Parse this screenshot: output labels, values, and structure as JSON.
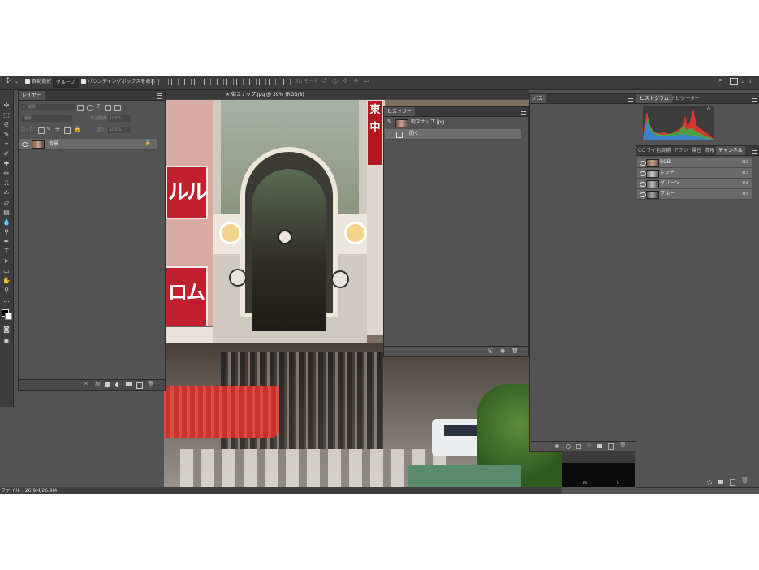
{
  "options_bar": {
    "auto_select_label": "自動選択",
    "auto_select_target": "グループ",
    "transform_label": "バウンディングボックスを表示",
    "mode_3d_label": "3D モード"
  },
  "document": {
    "tab_title": "街スナップ.jpg @ 39% (RGB/8)"
  },
  "status_bar": {
    "file_info": "ファイル : 26.9M/26.9M"
  },
  "layers_panel": {
    "tab": "レイヤー",
    "search_placeholder": "種類",
    "blend_mode": "通常",
    "opacity_label": "不透明度:",
    "opacity_value": "100%",
    "lock_label": "ロック:",
    "fill_label": "塗り:",
    "fill_value": "100%",
    "layers": [
      {
        "name": "背景"
      }
    ]
  },
  "history_panel": {
    "tab": "ヒストリー",
    "snapshot": "街スナップ.jpg",
    "states": [
      "開く"
    ]
  },
  "paths_panel": {
    "tab": "パス"
  },
  "histogram_panel": {
    "tabs": [
      "ヒストグラム",
      "ナビゲーター"
    ]
  },
  "channels_panel": {
    "tabs": [
      "CC ライ",
      "色調補",
      "アクシ",
      "属性",
      "情報",
      "チャンネル"
    ],
    "channels": [
      {
        "name": "RGB",
        "shortcut": "⌘2"
      },
      {
        "name": "レッド",
        "shortcut": "⌘3"
      },
      {
        "name": "グリーン",
        "shortcut": "⌘4"
      },
      {
        "name": "ブルー",
        "shortcut": "⌘5"
      }
    ]
  },
  "info_strip": {
    "values": [
      "16",
      "0"
    ]
  },
  "scene_signs": {
    "sign_left_upper": "ルル",
    "sign_left_lower": "ロム",
    "sign_right": "東中"
  },
  "colors": {
    "app_bg": "#535353",
    "panel_header": "#3a3a3a",
    "accent_red": "#c01f2d"
  }
}
